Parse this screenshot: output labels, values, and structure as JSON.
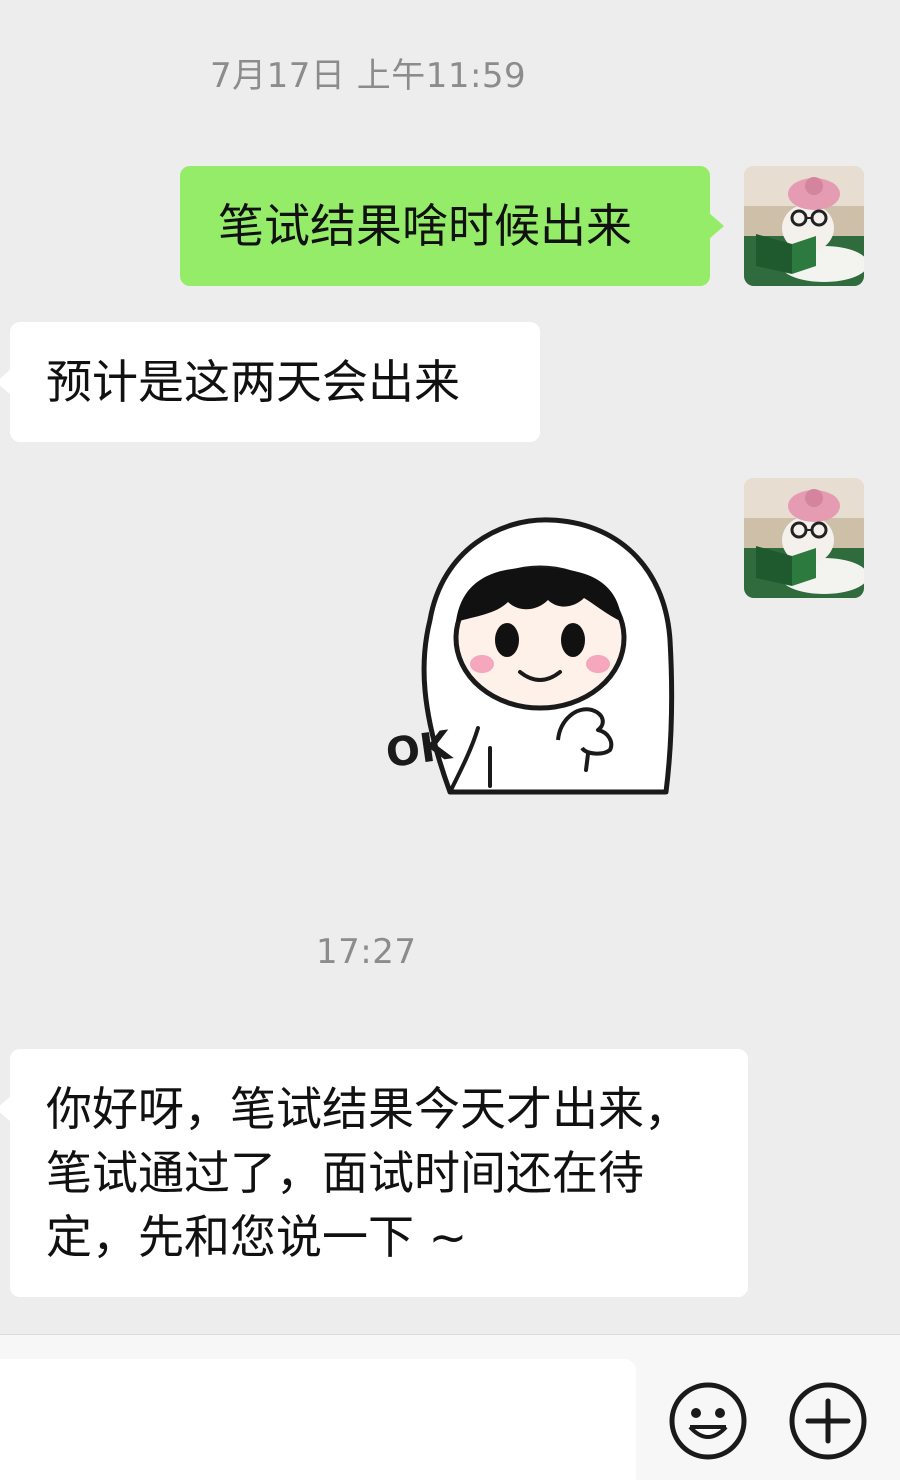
{
  "chat": {
    "timestamp_1": "7月17日 上午11:59",
    "msg_sent_1": "笔试结果啥时候出来",
    "msg_recv_1": "预计是这两天会出来",
    "sticker_text": "OK",
    "timestamp_2": "17:27",
    "msg_recv_2_lines": [
      "你好呀，笔试结果今天才出来，",
      "笔试通过了，面试时间还在待",
      "定，先和您说一下 ~"
    ]
  },
  "input_bar": {
    "placeholder": "",
    "emoji_icon": "smiley-face-icon",
    "more_icon": "plus-circle-icon"
  },
  "colors": {
    "background": "#ededed",
    "sent_bubble": "#95ec69",
    "received_bubble": "#ffffff",
    "timestamp_text": "#8c8c8c"
  }
}
